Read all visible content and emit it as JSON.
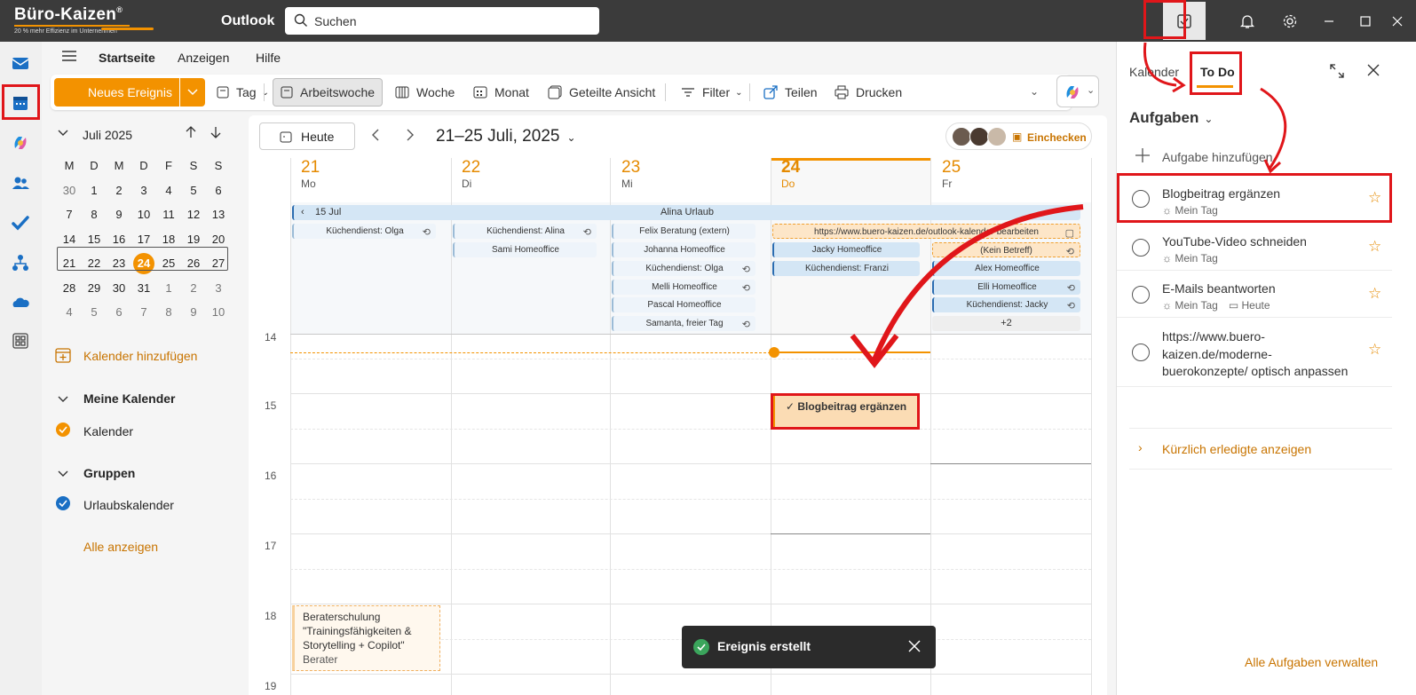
{
  "brand": {
    "name": "Büro-Kaizen",
    "reg": "®",
    "tagline": "20 % mehr Effizienz im Unternehmen"
  },
  "app": {
    "title": "Outlook"
  },
  "search": {
    "placeholder": "Suchen"
  },
  "menu": {
    "items": [
      "Startseite",
      "Anzeigen",
      "Hilfe"
    ]
  },
  "ribbon": {
    "new_event": "Neues Ereignis",
    "day": "Tag",
    "work_week": "Arbeitswoche",
    "week": "Woche",
    "month": "Monat",
    "split": "Geteilte Ansicht",
    "filter": "Filter",
    "share": "Teilen",
    "print": "Drucken"
  },
  "mini_cal": {
    "title": "Juli 2025",
    "weekdays": [
      "M",
      "D",
      "M",
      "D",
      "F",
      "S",
      "S"
    ],
    "weeks": [
      [
        "30",
        "1",
        "2",
        "3",
        "4",
        "5",
        "6"
      ],
      [
        "7",
        "8",
        "9",
        "10",
        "11",
        "12",
        "13"
      ],
      [
        "14",
        "15",
        "16",
        "17",
        "18",
        "19",
        "20"
      ],
      [
        "21",
        "22",
        "23",
        "24",
        "25",
        "26",
        "27"
      ],
      [
        "28",
        "29",
        "30",
        "31",
        "1",
        "2",
        "3"
      ],
      [
        "4",
        "5",
        "6",
        "7",
        "8",
        "9",
        "10"
      ]
    ]
  },
  "sidebar": {
    "add_calendar": "Kalender hinzufügen",
    "my_calendars": "Meine Kalender",
    "calendar": "Kalender",
    "groups": "Gruppen",
    "vacation": "Urlaubskalender",
    "show_all": "Alle anzeigen"
  },
  "calendar": {
    "today": "Heute",
    "range": "21–25 Juli, 2025",
    "checkin": "Einchecken",
    "days": [
      {
        "num": "21",
        "name": "Mo"
      },
      {
        "num": "22",
        "name": "Di"
      },
      {
        "num": "23",
        "name": "Mi"
      },
      {
        "num": "24",
        "name": "Do"
      },
      {
        "num": "25",
        "name": "Fr"
      }
    ],
    "banner_prev": "15 Jul",
    "banner": "Alina Urlaub",
    "mon": [
      "Küchendienst: Olga"
    ],
    "tue": [
      "Küchendienst: Alina",
      "Sami Homeoffice"
    ],
    "wed": [
      "Felix Beratung (extern)",
      "Johanna Homeoffice",
      "Küchendienst: Olga",
      "Melli Homeoffice",
      "Pascal Homeoffice",
      "Samanta, freier Tag"
    ],
    "thu_link": "https://www.buero-kaizen.de/outlook-kalender-bearbeiten",
    "thu": [
      "Jacky Homeoffice",
      "Küchendienst: Franzi"
    ],
    "fri": [
      "(Kein Betreff)",
      "Alex Homeoffice",
      "Elli Homeoffice",
      "Küchendienst: Jacky"
    ],
    "fri_more": "+2",
    "hours": [
      "14",
      "15",
      "16",
      "17",
      "18",
      "19"
    ],
    "task_event": "Blogbeitrag ergänzen",
    "training": {
      "title": "Beraterschulung \"Trainingsfähigkeiten & Storytelling + Copilot\"",
      "sub": "Berater"
    }
  },
  "todo": {
    "tab_calendar": "Kalender",
    "tab_todo": "To Do",
    "heading": "Aufgaben",
    "add": "Aufgabe hinzufügen",
    "tasks": [
      {
        "title": "Blogbeitrag ergänzen",
        "meta": "Mein Tag"
      },
      {
        "title": "YouTube-Video schneiden",
        "meta": "Mein Tag"
      },
      {
        "title": "E-Mails beantworten",
        "meta": "Mein Tag",
        "due": "Heute"
      },
      {
        "title_lines": [
          "https://www.buero-",
          "kaizen.de/moderne-",
          "buerokonzepte/ optisch anpassen"
        ]
      }
    ],
    "completed": "Kürzlich erledigte anzeigen",
    "manage": "Alle Aufgaben verwalten"
  },
  "toast": {
    "text": "Ereignis erstellt"
  },
  "colors": {
    "accent": "#f39200",
    "highlight": "#e0161a",
    "titlebar": "#3b3b3b"
  }
}
